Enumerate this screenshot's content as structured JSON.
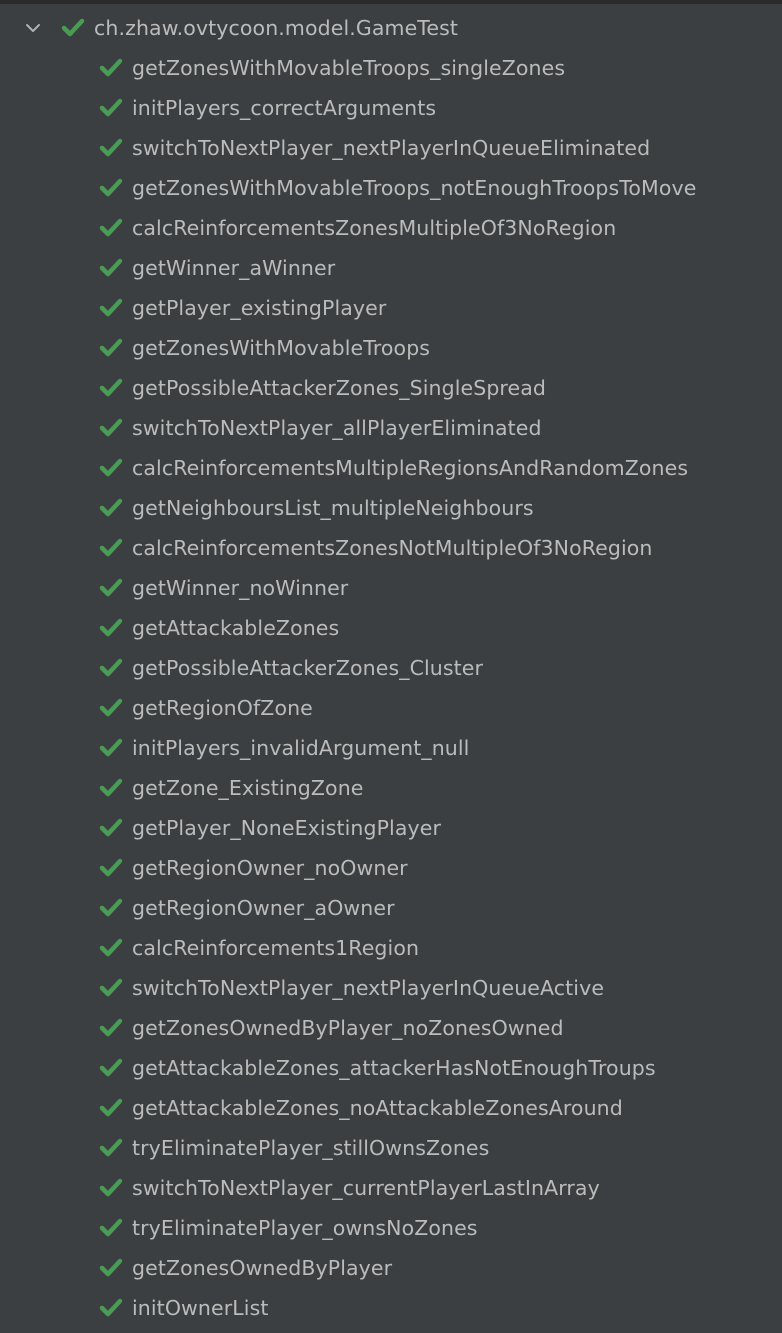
{
  "colors": {
    "background": "#3c3f41",
    "text": "#bbbbbb",
    "pass_check": "#499c54",
    "chevron": "#afb1b3"
  },
  "tree": {
    "root": {
      "label": "ch.zhaw.ovtycoon.model.GameTest",
      "expanded": true,
      "icon": "check-icon",
      "status": "passed"
    },
    "tests": [
      {
        "label": "getZonesWithMovableTroops_singleZones",
        "status": "passed"
      },
      {
        "label": "initPlayers_correctArguments",
        "status": "passed"
      },
      {
        "label": "switchToNextPlayer_nextPlayerInQueueEliminated",
        "status": "passed"
      },
      {
        "label": "getZonesWithMovableTroops_notEnoughTroopsToMove",
        "status": "passed"
      },
      {
        "label": "calcReinforcementsZonesMultipleOf3NoRegion",
        "status": "passed"
      },
      {
        "label": "getWinner_aWinner",
        "status": "passed"
      },
      {
        "label": "getPlayer_existingPlayer",
        "status": "passed"
      },
      {
        "label": "getZonesWithMovableTroops",
        "status": "passed"
      },
      {
        "label": "getPossibleAttackerZones_SingleSpread",
        "status": "passed"
      },
      {
        "label": "switchToNextPlayer_allPlayerEliminated",
        "status": "passed"
      },
      {
        "label": "calcReinforcementsMultipleRegionsAndRandomZones",
        "status": "passed"
      },
      {
        "label": "getNeighboursList_multipleNeighbours",
        "status": "passed"
      },
      {
        "label": "calcReinforcementsZonesNotMultipleOf3NoRegion",
        "status": "passed"
      },
      {
        "label": "getWinner_noWinner",
        "status": "passed"
      },
      {
        "label": "getAttackableZones",
        "status": "passed"
      },
      {
        "label": "getPossibleAttackerZones_Cluster",
        "status": "passed"
      },
      {
        "label": "getRegionOfZone",
        "status": "passed"
      },
      {
        "label": "initPlayers_invalidArgument_null",
        "status": "passed"
      },
      {
        "label": "getZone_ExistingZone",
        "status": "passed"
      },
      {
        "label": "getPlayer_NoneExistingPlayer",
        "status": "passed"
      },
      {
        "label": "getRegionOwner_noOwner",
        "status": "passed"
      },
      {
        "label": "getRegionOwner_aOwner",
        "status": "passed"
      },
      {
        "label": "calcReinforcements1Region",
        "status": "passed"
      },
      {
        "label": "switchToNextPlayer_nextPlayerInQueueActive",
        "status": "passed"
      },
      {
        "label": "getZonesOwnedByPlayer_noZonesOwned",
        "status": "passed"
      },
      {
        "label": "getAttackableZones_attackerHasNotEnoughTroups",
        "status": "passed"
      },
      {
        "label": "getAttackableZones_noAttackableZonesAround",
        "status": "passed"
      },
      {
        "label": "tryEliminatePlayer_stillOwnsZones",
        "status": "passed"
      },
      {
        "label": "switchToNextPlayer_currentPlayerLastInArray",
        "status": "passed"
      },
      {
        "label": "tryEliminatePlayer_ownsNoZones",
        "status": "passed"
      },
      {
        "label": "getZonesOwnedByPlayer",
        "status": "passed"
      },
      {
        "label": "initOwnerList",
        "status": "passed"
      }
    ]
  }
}
